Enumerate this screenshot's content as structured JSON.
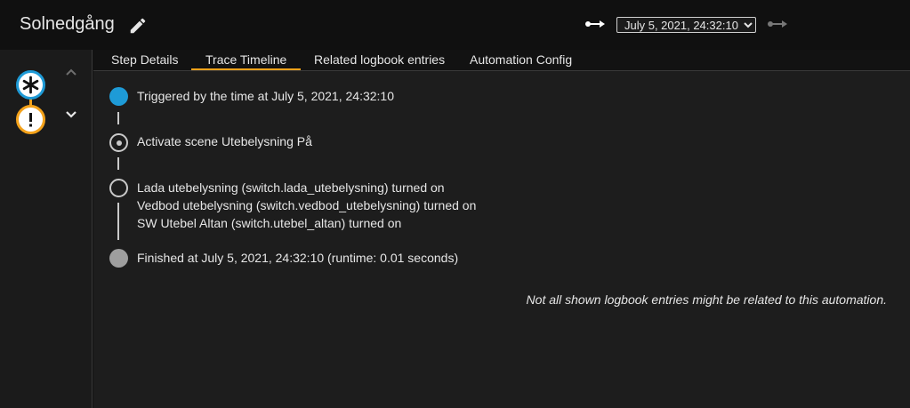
{
  "header": {
    "title": "Solnedgång",
    "trace_selected": "July 5, 2021, 24:32:10"
  },
  "tabs": [
    {
      "label": "Step Details"
    },
    {
      "label": "Trace Timeline"
    },
    {
      "label": "Related logbook entries"
    },
    {
      "label": "Automation Config"
    }
  ],
  "timeline": {
    "triggered": "Triggered by the time at July 5, 2021, 24:32:10",
    "scene": "Activate scene Utebelysning På",
    "switches": [
      "Lada utebelysning (switch.lada_utebelysning) turned on",
      "Vedbod utebelysning (switch.vedbod_utebelysning) turned on",
      "SW Utebel Altan (switch.utebel_altan) turned on"
    ],
    "finished": "Finished at July 5, 2021, 24:32:10 (runtime: 0.01 seconds)"
  },
  "note": "Not all shown logbook entries might be related to this automation.",
  "icons": {
    "edit": "pencil-icon",
    "prev": "trace-prev-icon",
    "next": "trace-next-icon",
    "trigger": "asterisk-icon",
    "condition": "exclamation-icon"
  },
  "colors": {
    "accent": "#f4a21a",
    "trigger": "#1e9ad6",
    "trigger_dot": "#1e9bd7"
  }
}
